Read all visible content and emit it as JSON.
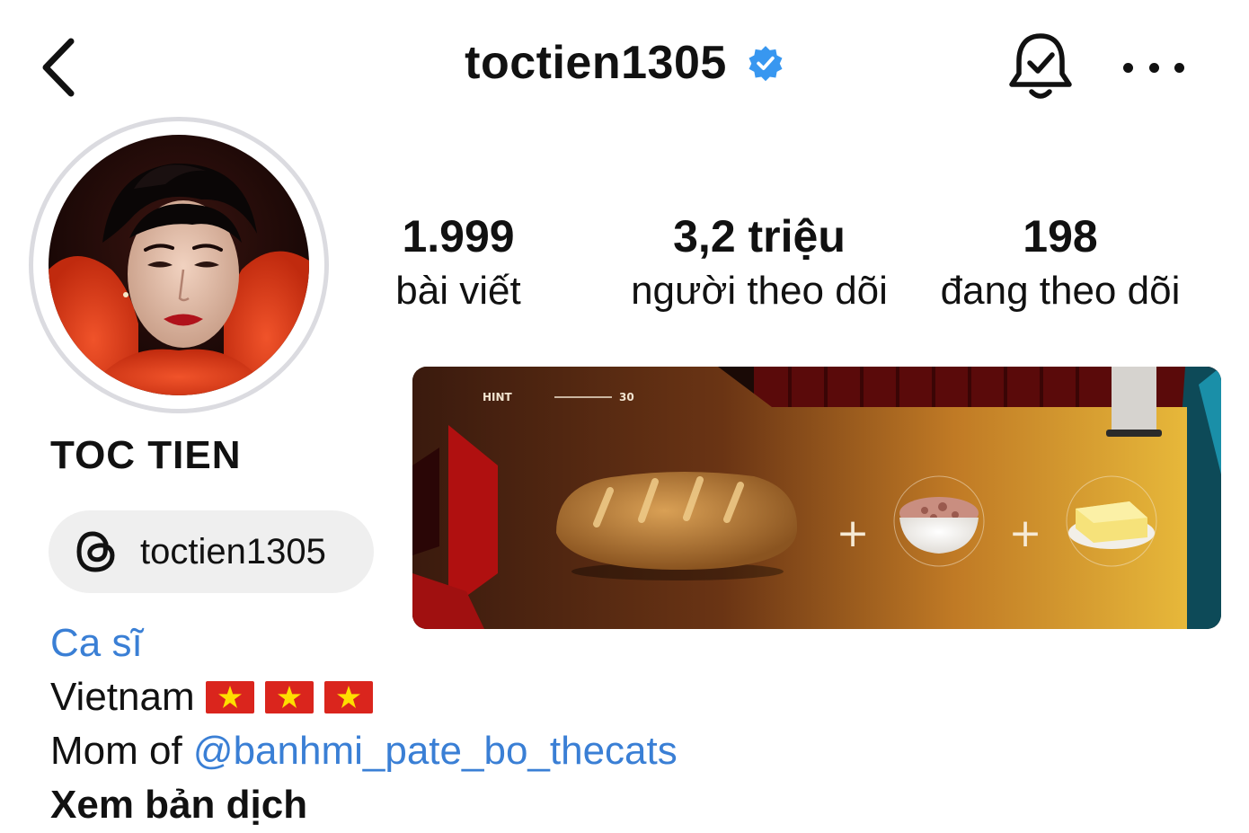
{
  "header": {
    "username": "toctien1305",
    "verified": true,
    "icons": {
      "back": "chevron-left-icon",
      "verified": "verified-badge-icon",
      "notifications": "bell-check-icon",
      "more": "more-horizontal-icon"
    }
  },
  "stats": {
    "posts": {
      "value": "1.999",
      "label": "bài viết"
    },
    "followers": {
      "value": "3,2 triệu",
      "label": "người theo dõi"
    },
    "following": {
      "value": "198",
      "label": "đang theo dõi"
    }
  },
  "profile": {
    "display_name": "TOC TIEN",
    "threads_handle": "toctien1305",
    "category": "Ca sĩ",
    "location": "Vietnam",
    "flags": [
      "vietnam-flag-icon",
      "vietnam-flag-icon",
      "vietnam-flag-icon"
    ],
    "bio_prefix": "Mom of ",
    "bio_mention": "@banhmi_pate_bo_thecats",
    "translate_label": "Xem bản dịch"
  },
  "banner": {
    "hint_label": "HINT",
    "hint_number": "30",
    "plus_sign": "+"
  },
  "colors": {
    "link": "#3a7fd5",
    "verified": "#3897f0",
    "chip_bg": "#efefef",
    "flag_red": "#da251d",
    "flag_star": "#ffde00"
  }
}
